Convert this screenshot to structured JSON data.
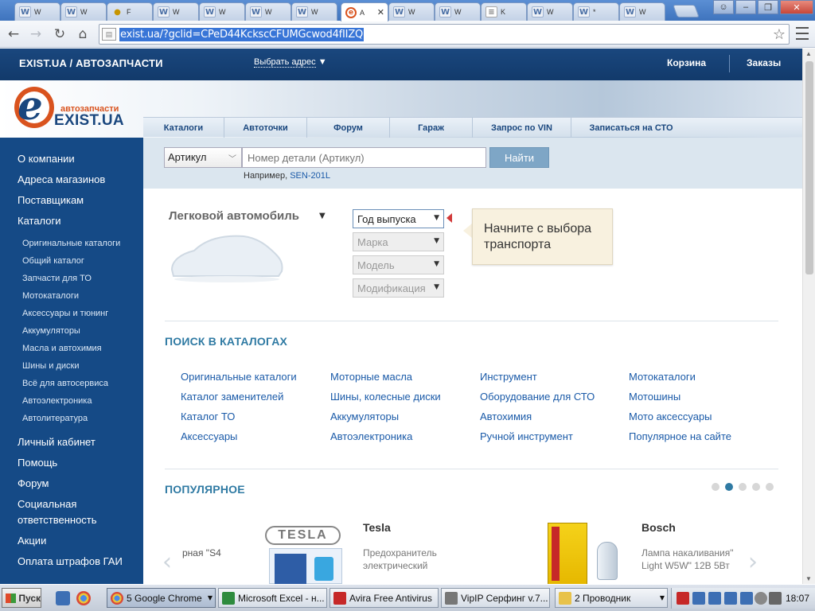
{
  "browser": {
    "tabs": [
      {
        "title": "W",
        "icon": "wiki-w-icon"
      },
      {
        "title": "W",
        "icon": "wiki-w-icon"
      },
      {
        "title": "F",
        "icon": "coin-icon"
      },
      {
        "title": "W",
        "icon": "wiki-w-icon"
      },
      {
        "title": "W",
        "icon": "wiki-w-icon"
      },
      {
        "title": "W",
        "icon": "wiki-w-icon"
      },
      {
        "title": "W",
        "icon": "wiki-w-icon"
      },
      {
        "title": "A",
        "icon": "exist-favicon",
        "active": true
      },
      {
        "title": "W",
        "icon": "wiki-w-icon"
      },
      {
        "title": "W",
        "icon": "wiki-w-icon"
      },
      {
        "title": "K",
        "icon": "document-icon"
      },
      {
        "title": "W",
        "icon": "wiki-w-icon"
      },
      {
        "title": "*",
        "icon": "wiki-w-icon"
      },
      {
        "title": "W",
        "icon": "wiki-w-icon"
      }
    ],
    "url": "exist.ua/?gclid=CPeD44KckscCFUMGcwod4fIIZQ"
  },
  "site": {
    "brand": "EXIST.UA / АВТОЗАПЧАСТИ",
    "address_select": "Выбрать адрес",
    "cart": "Корзина",
    "orders": "Заказы",
    "logo_sub": "автозапчасти",
    "logo_name": "EXIST.UA",
    "nav": [
      "Каталоги",
      "Автоточки",
      "Форум",
      "Гараж",
      "Запрос по VIN",
      "Записаться на СТО"
    ]
  },
  "sidebar": {
    "items_top": [
      "О компании",
      "Адреса магазинов",
      "Поставщикам",
      "Каталоги"
    ],
    "catalog_sub": [
      "Оригинальные каталоги",
      "Общий каталог",
      "Запчасти для ТО",
      "Мотокаталоги",
      "Аксессуары и тюнинг",
      "Аккумуляторы",
      "Масла и автохимия",
      "Шины и диски",
      "Всё для автосервиса",
      "Автоэлектроника",
      "Автолитература"
    ],
    "items_bottom": [
      "Личный кабинет",
      "Помощь",
      "Форум",
      "Социальная",
      "ответственность",
      "Акции",
      "Оплата штрафов ГАИ"
    ]
  },
  "search": {
    "type_select": "Артикул",
    "placeholder": "Номер детали (Артикул)",
    "button": "Найти",
    "example_label": "Например,",
    "example_link": "SEN-201L"
  },
  "vehicle": {
    "type": "Легковой автомобиль",
    "selects": [
      "Год выпуска",
      "Марка",
      "Модель",
      "Модификация"
    ],
    "tooltip": "Начните с выбора транспорта"
  },
  "catalogs": {
    "title": "ПОИСК В КАТАЛОГАХ",
    "columns": [
      [
        "Оригинальные каталоги",
        "Каталог заменителей",
        "Каталог ТО",
        "Аксессуары"
      ],
      [
        "Моторные масла",
        "Шины, колесные диски",
        "Аккумуляторы",
        "Автоэлектроника"
      ],
      [
        "Инструмент",
        "Оборудование для СТО",
        "Автохимия",
        "Ручной инструмент"
      ],
      [
        "Мотокаталоги",
        "Мотошины",
        "Мото аксессуары",
        "Популярное на сайте"
      ]
    ]
  },
  "popular": {
    "title": "ПОПУЛЯРНОЕ",
    "pages": 5,
    "active_page": 2,
    "cut_text": "рная \"S4",
    "products": [
      {
        "brand": "Tesla",
        "logo_text": "TESLA",
        "desc1": "Предохранитель",
        "desc2": "электрический"
      },
      {
        "brand": "Bosch",
        "desc1": "Лампа накаливания\"",
        "desc2": "Light W5W\" 12В 5Вт"
      }
    ]
  },
  "taskbar": {
    "start": "Пуск",
    "buttons": [
      {
        "label": "5 Google Chrome",
        "icon": "chrome-icon",
        "active": true
      },
      {
        "label": "Microsoft Excel - н...",
        "icon": "excel-icon"
      },
      {
        "label": "Avira Free Antivirus",
        "icon": "avira-icon"
      },
      {
        "label": "VipIP Серфинг v.7...",
        "icon": "vipip-icon"
      },
      {
        "label": "2 Проводник",
        "icon": "folder-icon"
      }
    ],
    "clock": "18:07"
  },
  "colors": {
    "sidebar": "#154a86",
    "topbar": "#1a477e",
    "accent": "#d9531e",
    "link": "#1a5aa8",
    "section_title": "#2f7aa3"
  }
}
